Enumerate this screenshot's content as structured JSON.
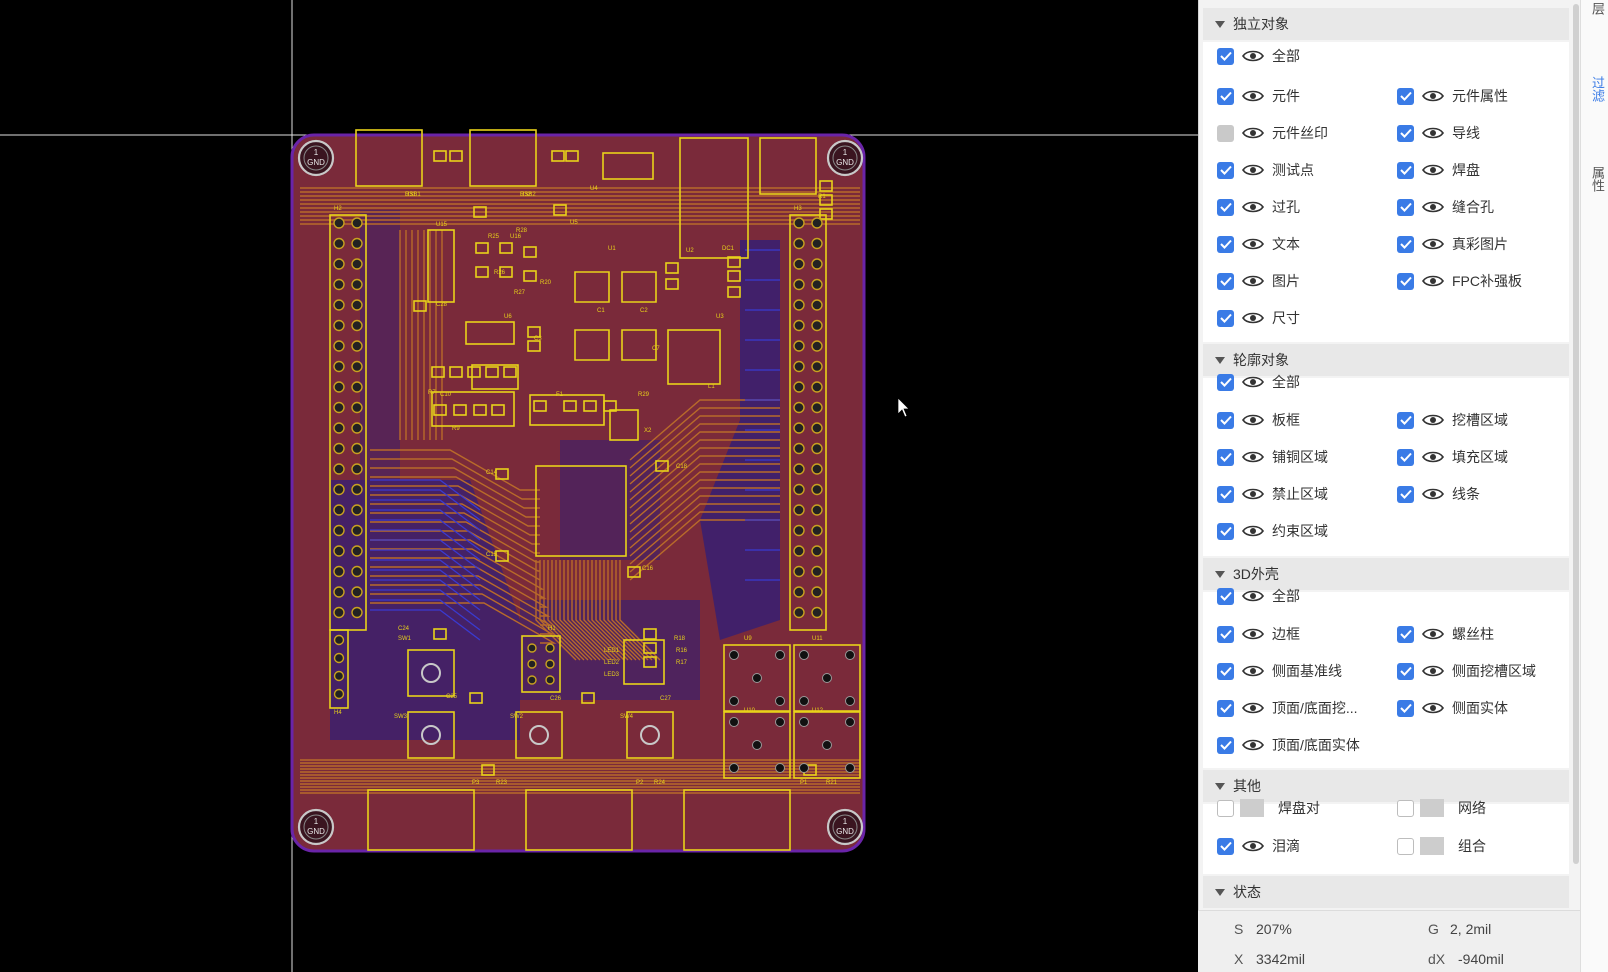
{
  "sections": [
    {
      "title": "独立对象",
      "items": [
        {
          "label": "全部",
          "state": "checked",
          "visible": true
        },
        {
          "label": "元件",
          "state": "checked",
          "visible": true
        },
        {
          "label": "元件属性",
          "state": "checked",
          "visible": true
        },
        {
          "label": "元件丝印",
          "state": "gray",
          "visible": true
        },
        {
          "label": "导线",
          "state": "checked",
          "visible": true
        },
        {
          "label": "测试点",
          "state": "checked",
          "visible": true
        },
        {
          "label": "焊盘",
          "state": "checked",
          "visible": true
        },
        {
          "label": "过孔",
          "state": "checked",
          "visible": true
        },
        {
          "label": "缝合孔",
          "state": "checked",
          "visible": true
        },
        {
          "label": "文本",
          "state": "checked",
          "visible": true
        },
        {
          "label": "真彩图片",
          "state": "checked",
          "visible": true
        },
        {
          "label": "图片",
          "state": "checked",
          "visible": true
        },
        {
          "label": "FPC补强板",
          "state": "checked",
          "visible": true
        },
        {
          "label": "尺寸",
          "state": "checked",
          "visible": true
        }
      ]
    },
    {
      "title": "轮廓对象",
      "items": [
        {
          "label": "全部",
          "state": "checked",
          "visible": true
        },
        {
          "label": "板框",
          "state": "checked",
          "visible": true
        },
        {
          "label": "挖槽区域",
          "state": "checked",
          "visible": true
        },
        {
          "label": "铺铜区域",
          "state": "checked",
          "visible": true
        },
        {
          "label": "填充区域",
          "state": "checked",
          "visible": true
        },
        {
          "label": "禁止区域",
          "state": "checked",
          "visible": true
        },
        {
          "label": "线条",
          "state": "checked",
          "visible": true
        },
        {
          "label": "约束区域",
          "state": "checked",
          "visible": true
        }
      ]
    },
    {
      "title": "3D外壳",
      "items": [
        {
          "label": "全部",
          "state": "checked",
          "visible": true
        },
        {
          "label": "边框",
          "state": "checked",
          "visible": true
        },
        {
          "label": "螺丝柱",
          "state": "checked",
          "visible": true
        },
        {
          "label": "侧面基准线",
          "state": "checked",
          "visible": true
        },
        {
          "label": "侧面挖槽区域",
          "state": "checked",
          "visible": true
        },
        {
          "label": "顶面/底面挖...",
          "state": "checked",
          "visible": true
        },
        {
          "label": "侧面实体",
          "state": "checked",
          "visible": true
        },
        {
          "label": "顶面/底面实体",
          "state": "checked",
          "visible": true
        }
      ]
    },
    {
      "title": "其他",
      "items": [
        {
          "label": "焊盘对",
          "state": "empty",
          "visible": false
        },
        {
          "label": "网络",
          "state": "empty",
          "visible": false
        },
        {
          "label": "泪滴",
          "state": "checked",
          "visible": true
        },
        {
          "label": "组合",
          "state": "empty",
          "visible": false
        }
      ]
    },
    {
      "title": "状态",
      "items": []
    }
  ],
  "status": {
    "s_key": "S",
    "s_val": "207%",
    "g_key": "G",
    "g_val": "2, 2mil",
    "x_key": "X",
    "x_val": "3342mil",
    "dx_key": "dX",
    "dx_val": "-940mil"
  },
  "tabs": [
    {
      "label": "层"
    },
    {
      "label": "过滤",
      "active": true
    },
    {
      "label": "属性"
    }
  ],
  "pcb": {
    "gnd_label": "GND",
    "pin_label": "1",
    "refdes": [
      "USB1",
      "USB2",
      "U4",
      "U5",
      "U15",
      "U16",
      "U1",
      "U2",
      "DC1",
      "U3",
      "U6",
      "H2",
      "H3",
      "H1",
      "H4",
      "L1",
      "F1",
      "X2",
      "SW1",
      "SW2",
      "SW3",
      "SW4",
      "U9",
      "U10",
      "U11",
      "U12",
      "P1",
      "P2",
      "P3",
      "LED1",
      "LED2",
      "LED3",
      "C1",
      "C2",
      "C3",
      "C7",
      "C10",
      "C14",
      "C15",
      "C16",
      "C18",
      "C24",
      "C25",
      "C26",
      "C27",
      "C28",
      "R1",
      "R7",
      "R9",
      "R16",
      "R17",
      "R18",
      "R20",
      "R21",
      "R23",
      "R24",
      "R25",
      "R26",
      "R27",
      "R28",
      "R29",
      "R31",
      "R32"
    ]
  },
  "colors": {
    "board": "#7a2a3a",
    "board_edge": "#6a24a8",
    "silk": "#e8d21a",
    "bottom_copper": "#1a1a8a",
    "checkbox": "#3a7be6",
    "accent": "#3a7be6"
  }
}
